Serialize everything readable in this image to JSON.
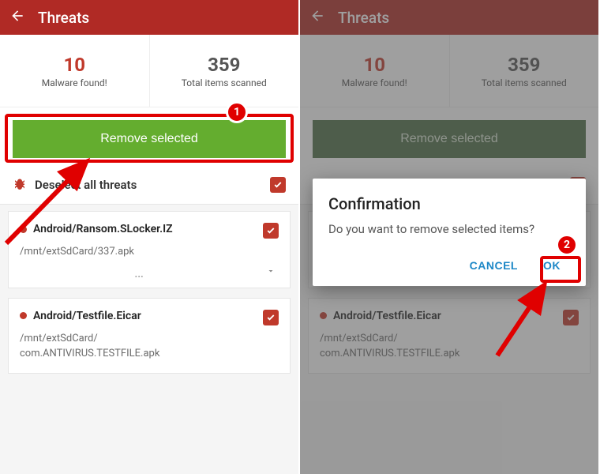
{
  "header": {
    "title": "Threats"
  },
  "stats": {
    "malware_count": "10",
    "malware_label": "Malware found!",
    "scanned_count": "359",
    "scanned_label": "Total items scanned"
  },
  "actions": {
    "remove_label": "Remove selected",
    "deselect_label": "Deselect all threats"
  },
  "threats": [
    {
      "name": "Android/Ransom.SLocker.IZ",
      "path": "/mnt/extSdCard/337.apk"
    },
    {
      "name": "Android/Testfile.Eicar",
      "path": "/mnt/extSdCard/\ncom.ANTIVIRUS.TESTFILE.apk"
    }
  ],
  "dialog": {
    "title": "Confirmation",
    "body": "Do you want to remove selected items?",
    "cancel": "CANCEL",
    "ok": "OK"
  },
  "annot": {
    "step1": "1",
    "step2": "2"
  }
}
